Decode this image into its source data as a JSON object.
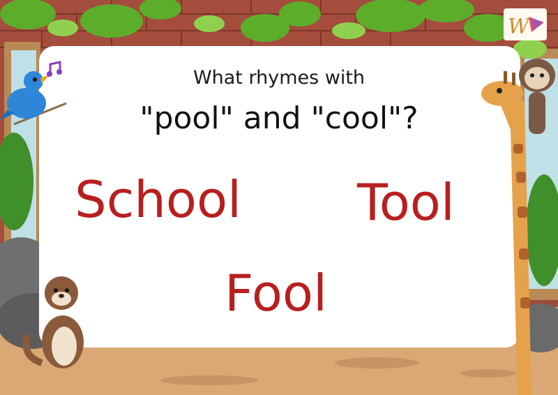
{
  "question": {
    "line1": "What rhymes with",
    "line2": "\"pool\" and \"cool\"?"
  },
  "answers": [
    "School",
    "Tool",
    "Fool"
  ],
  "colors": {
    "answer": "#b81f1f",
    "brick": "#9c4a3b",
    "ground": "#e3b98a",
    "leaf": "#5cae2a"
  },
  "logo": {
    "text": "W"
  },
  "illustrations": [
    "bird-icon",
    "music-note-icon",
    "giraffe-icon",
    "sloth-icon",
    "otter-icon",
    "rock-icon",
    "leaf-icon"
  ]
}
